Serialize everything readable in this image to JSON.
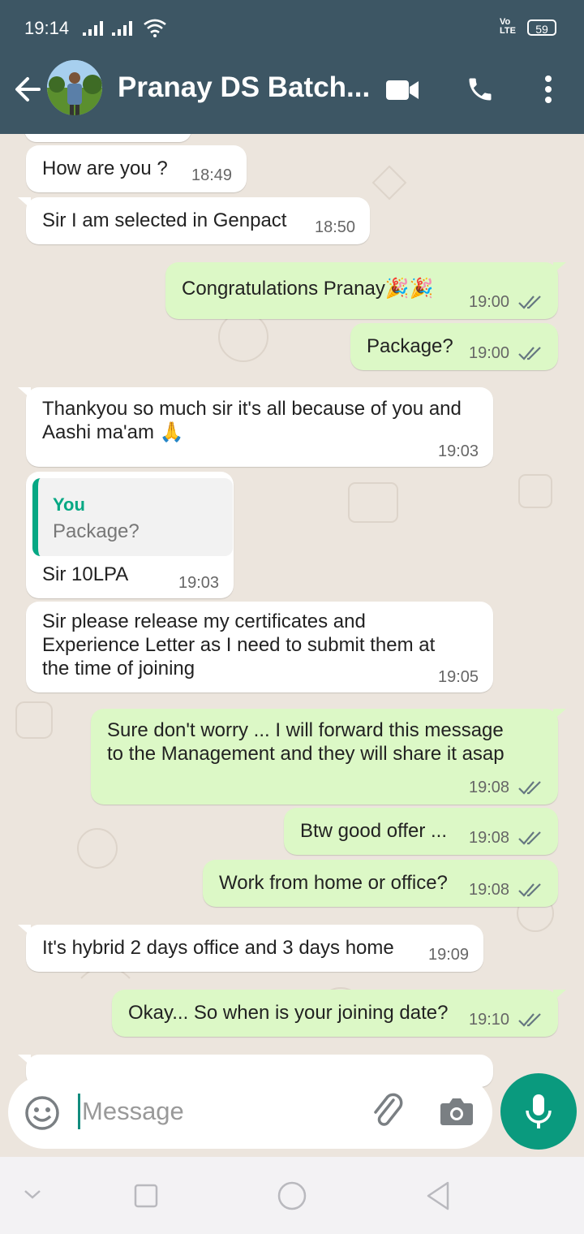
{
  "status": {
    "time": "19:14",
    "volte": "VoLTE",
    "battery": "59"
  },
  "header": {
    "title": "Pranay DS Batch..."
  },
  "messages": [
    {
      "dir": "in",
      "text": "How are you ?",
      "time": "18:49"
    },
    {
      "dir": "in",
      "text": "Sir I am selected in Genpact",
      "time": "18:50"
    },
    {
      "dir": "out",
      "text": "Congratulations Pranay🎉🎉",
      "time": "19:00"
    },
    {
      "dir": "out",
      "text": "Package?",
      "time": "19:00"
    },
    {
      "dir": "in",
      "text": "Thankyou so much sir it's all because of you and\nAashi ma'am 🙏",
      "time": "19:03"
    },
    {
      "dir": "in",
      "quote_author": "You",
      "quote_text": "Package?",
      "text": "Sir 10LPA",
      "time": "19:03"
    },
    {
      "dir": "in",
      "text": "Sir please release my certificates and\nExperience Letter as I need to submit them at\nthe time of joining",
      "time": "19:05"
    },
    {
      "dir": "out",
      "text": "Sure don't worry ... I will forward this message\nto the Management and they will share it asap",
      "time": "19:08"
    },
    {
      "dir": "out",
      "text": "Btw good offer ...",
      "time": "19:08"
    },
    {
      "dir": "out",
      "text": "Work from home or office?",
      "time": "19:08"
    },
    {
      "dir": "in",
      "text": "It's hybrid 2 days office and 3 days home",
      "time": "19:09"
    },
    {
      "dir": "out",
      "text": "Okay... So when is your joining date?",
      "time": "19:10"
    }
  ],
  "composer": {
    "placeholder": "Message"
  },
  "colors": {
    "header": "#3d5664",
    "outgoing": "#dcf8c6",
    "incoming": "#ffffff",
    "accent": "#0a9a7e",
    "tick": "#667781"
  },
  "icons": [
    "back-arrow-icon",
    "video-call-icon",
    "phone-icon",
    "more-options-icon",
    "emoji-icon",
    "attach-icon",
    "camera-icon",
    "mic-icon"
  ]
}
